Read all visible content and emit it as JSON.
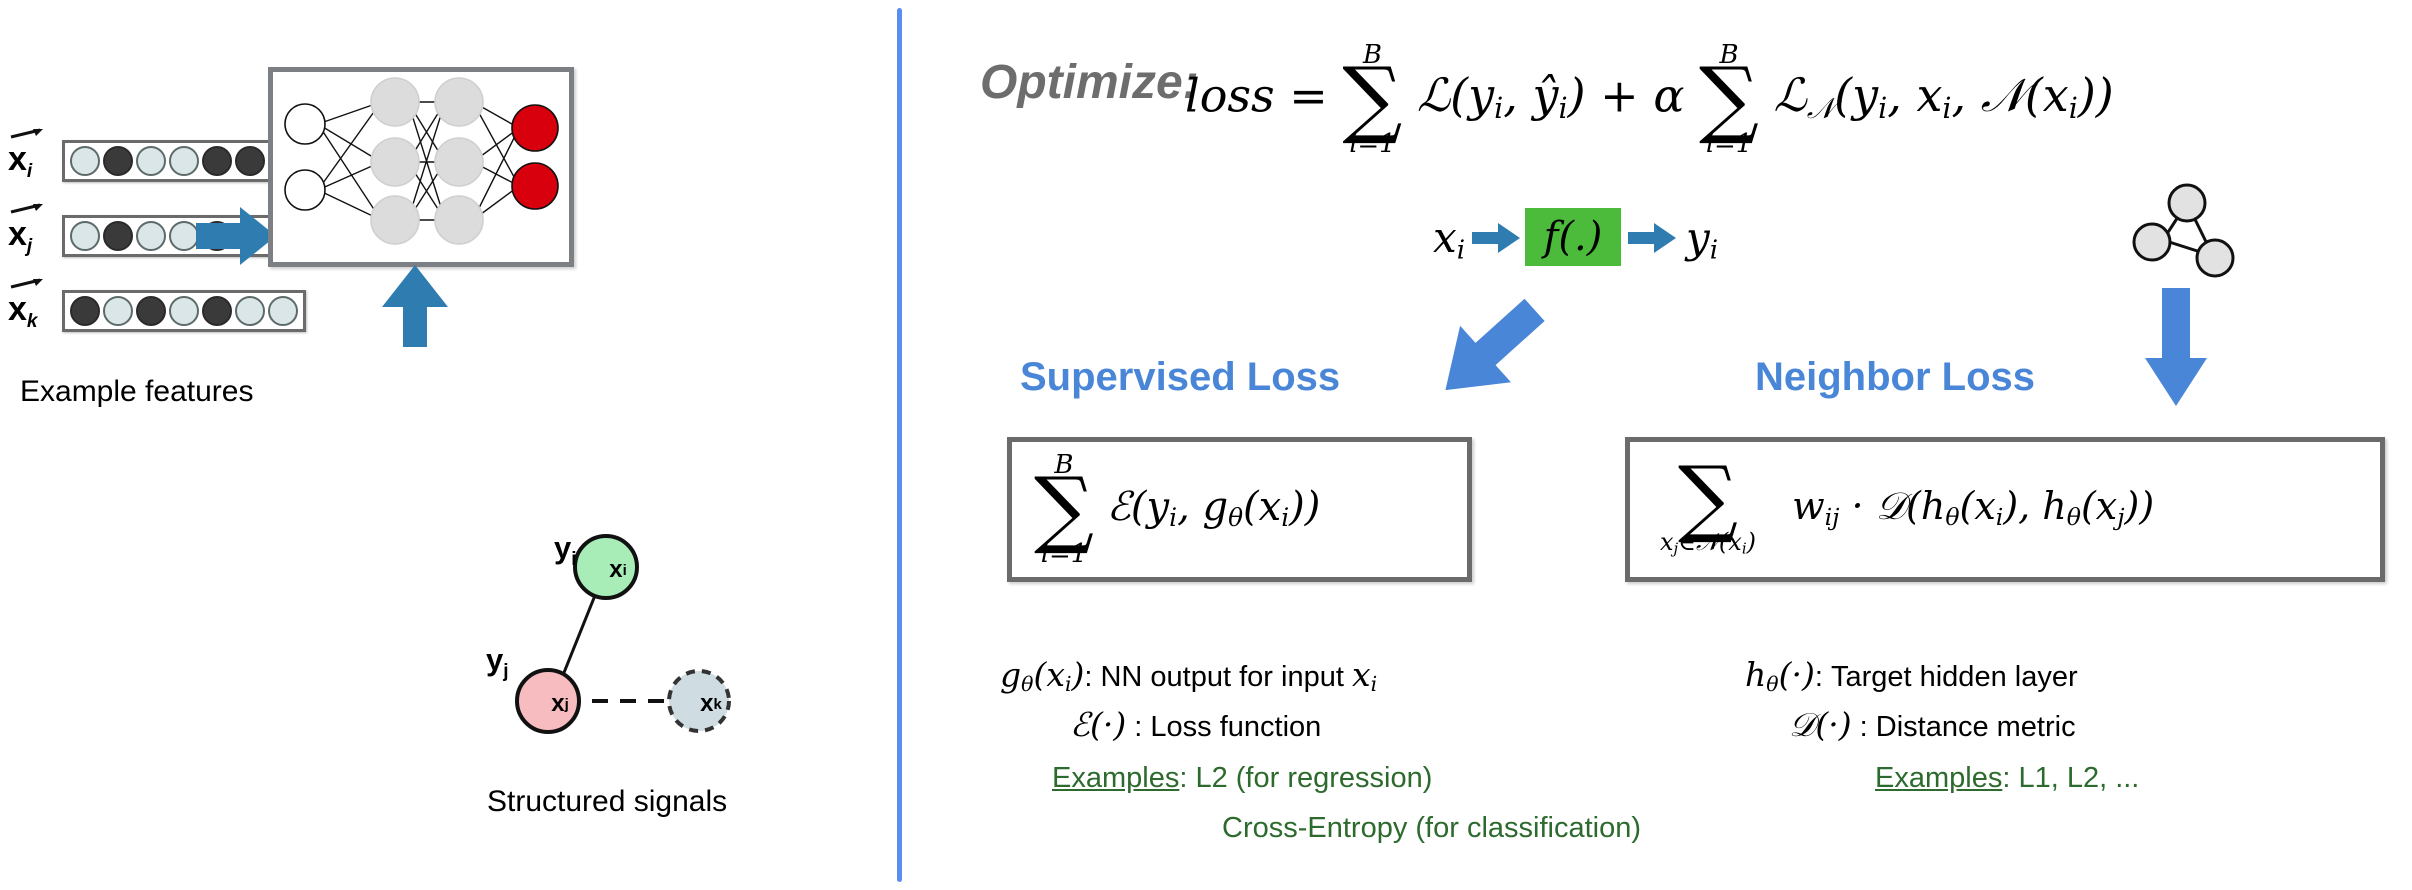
{
  "left_panel": {
    "vectors": [
      {
        "label": "x",
        "subscript": "i",
        "dots": [
          "light",
          "dark",
          "light",
          "light",
          "dark",
          "dark",
          "light"
        ]
      },
      {
        "label": "x",
        "subscript": "j",
        "dots": [
          "light",
          "dark",
          "light",
          "light",
          "dark",
          "light",
          "light"
        ]
      },
      {
        "label": "x",
        "subscript": "k",
        "dots": [
          "dark",
          "light",
          "dark",
          "light",
          "dark",
          "light",
          "light"
        ]
      }
    ],
    "features_caption": "Example features",
    "signals_caption": "Structured signals",
    "graph": {
      "nodes": [
        {
          "id": "xi",
          "label": "x",
          "sub": "i",
          "fill": "#a8edb8",
          "stroke": "#111111",
          "dashed": false,
          "ylabel": "y",
          "ysub": "i"
        },
        {
          "id": "xj",
          "label": "x",
          "sub": "j",
          "fill": "#f7bcc0",
          "stroke": "#111111",
          "dashed": false,
          "ylabel": "y",
          "ysub": "j"
        },
        {
          "id": "xk",
          "label": "x",
          "sub": "k",
          "fill": "#cfdce2",
          "stroke": "#333333",
          "dashed": true,
          "ylabel": "",
          "ysub": ""
        }
      ],
      "edges": [
        {
          "from": "xj",
          "to": "xi",
          "style": "solid"
        },
        {
          "from": "xj",
          "to": "xk",
          "style": "dashed"
        }
      ]
    },
    "network": {
      "layers": [
        {
          "name": "input",
          "count": 2,
          "fill": "#ffffff"
        },
        {
          "name": "hidden1",
          "count": 3,
          "fill": "#dcdcdc"
        },
        {
          "name": "hidden2",
          "count": 3,
          "fill": "#dcdcdc"
        },
        {
          "name": "output",
          "count": 2,
          "fill": "#d8000c"
        }
      ]
    }
  },
  "right_panel": {
    "optimize_label": "Optimize:",
    "formula": {
      "lhs": "loss",
      "eq": "=",
      "sum1": {
        "upper": "B",
        "lower": "i=1"
      },
      "term1": "L(y_i, ŷ_i)",
      "plus": "+",
      "alpha": "α",
      "sum2": {
        "upper": "B",
        "lower": "i=1"
      },
      "term2": "L_N(y_i, x_i, N(x_i))"
    },
    "pipeline": {
      "input": "x",
      "input_sub": "i",
      "box": "f(.)",
      "output": "y",
      "output_sub": "i",
      "box_color": "#4cbb3c"
    },
    "supervised": {
      "title": "Supervised Loss",
      "formula": {
        "sum": {
          "upper": "B",
          "lower": "i=1"
        },
        "body": "E(y_i, g_θ(x_i))"
      },
      "legend": [
        {
          "symbol": "g_θ(x_i)",
          "sep": ":",
          "text": "NN output for input",
          "trailing_math": "x_i"
        },
        {
          "symbol": "E(·)",
          "sep": ":",
          "text": "Loss function",
          "trailing_math": ""
        }
      ],
      "examples_label": "Examples",
      "examples": [
        "L2 (for regression)",
        "Cross-Entropy (for classification)"
      ]
    },
    "neighbor": {
      "title": "Neighbor Loss",
      "formula": {
        "sum": {
          "lower": "x_j∈N(x_i)"
        },
        "body": "w_ij · D(h_θ(x_i), h_θ(x_j))"
      },
      "legend": [
        {
          "symbol": "h_θ(·)",
          "sep": ":",
          "text": "Target hidden layer"
        },
        {
          "symbol": "D(·)",
          "sep": ":",
          "text": "Distance metric"
        }
      ],
      "examples_label": "Examples",
      "examples": [
        "L1, L2, ..."
      ]
    }
  },
  "colors": {
    "accent_blue": "#2e7cb0",
    "label_blue": "#4a86d8",
    "divider_blue": "#5b8def",
    "green_box": "#4cbb3c",
    "green_text": "#2d6a2d",
    "red_node": "#d8000c",
    "gray_label": "#6d6d6d",
    "box_border": "#6b6b6b"
  }
}
